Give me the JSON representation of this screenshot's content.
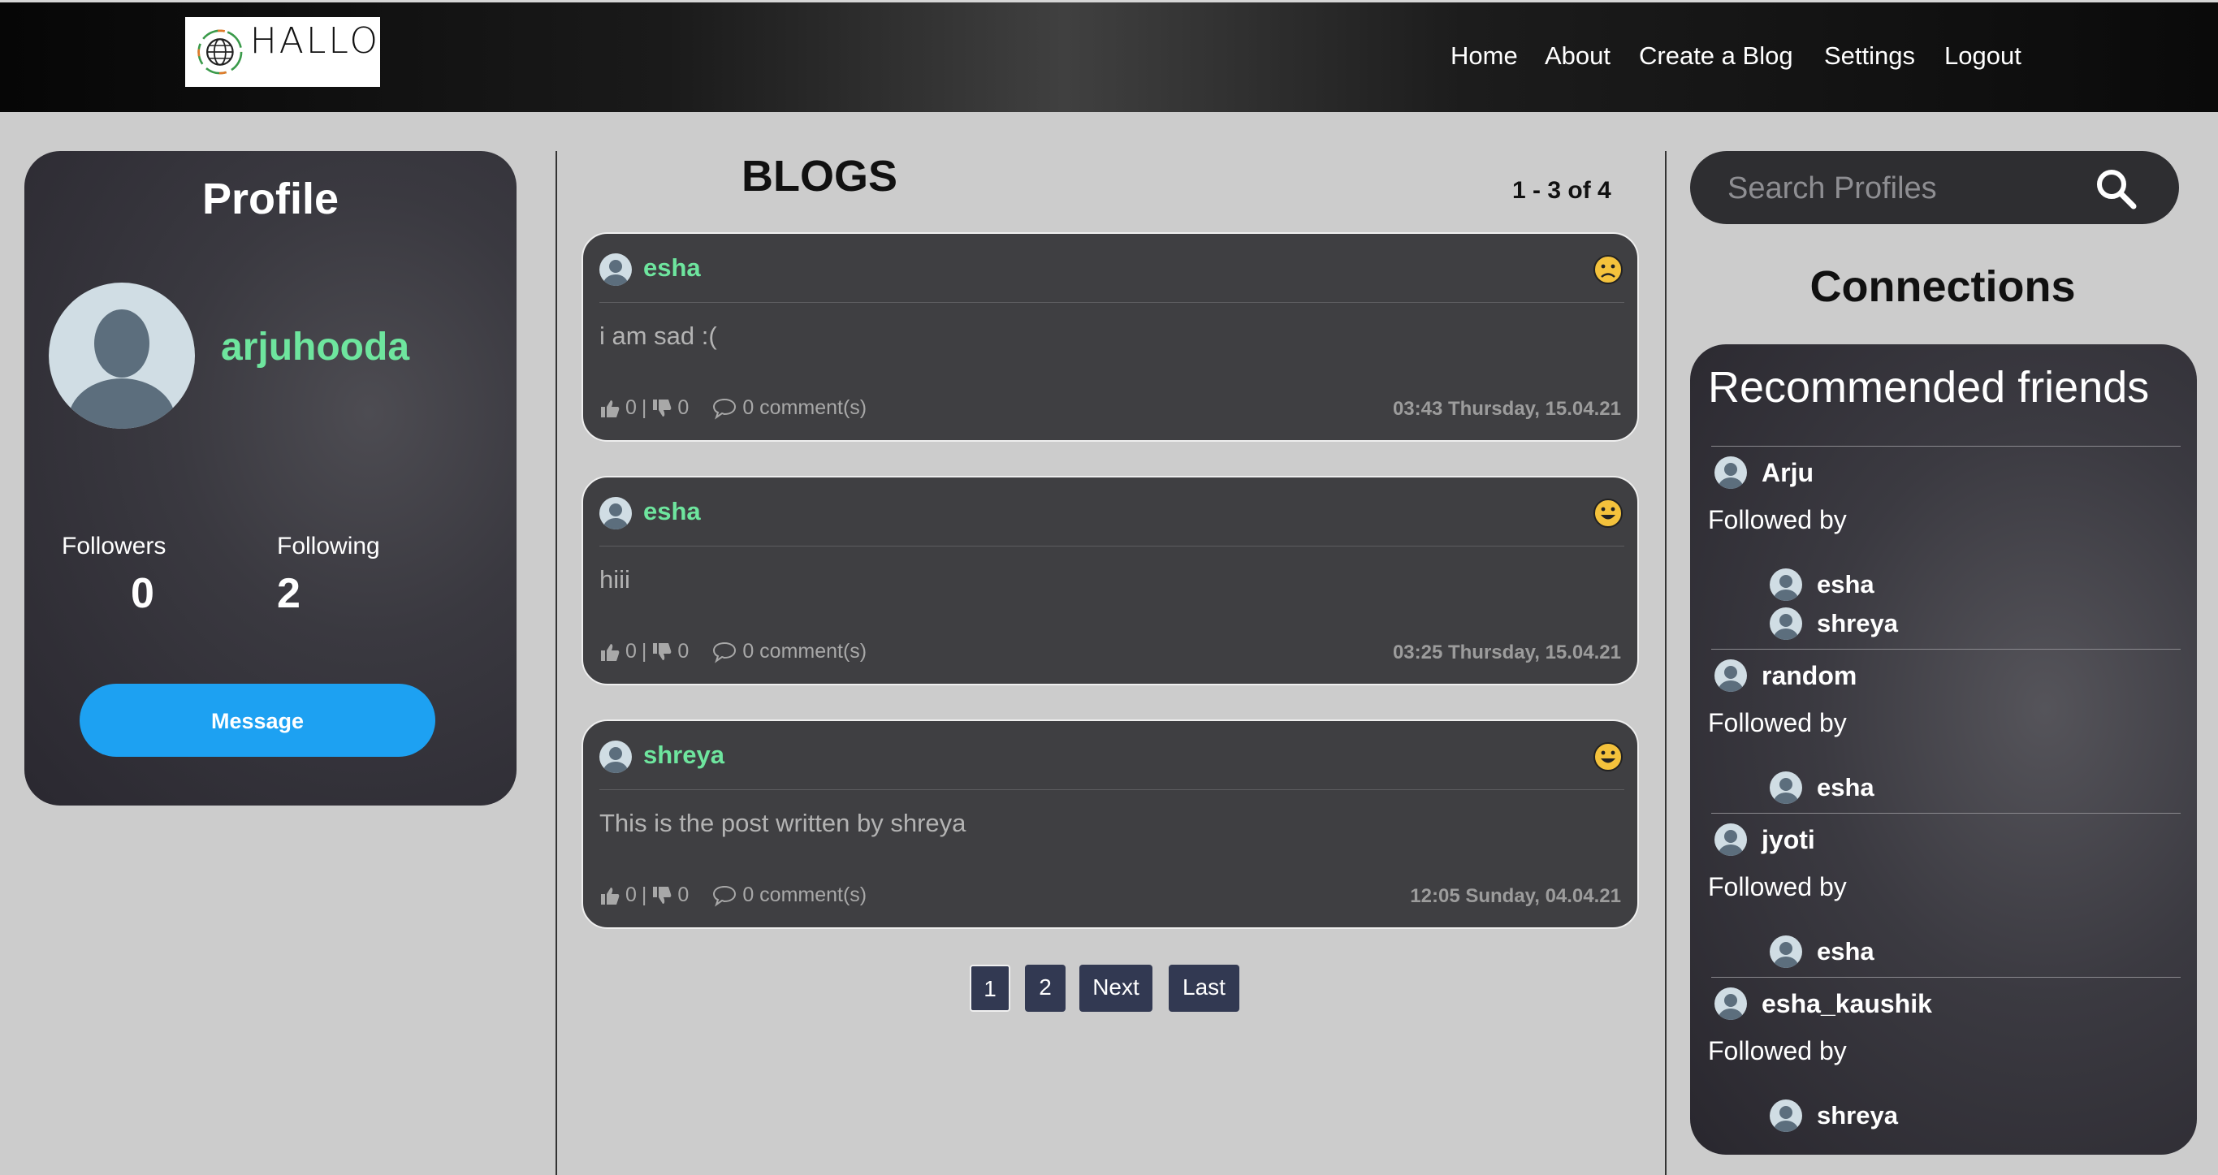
{
  "brand": {
    "logo_text": "HALLO"
  },
  "nav": [
    {
      "label": "Home"
    },
    {
      "label": "About"
    },
    {
      "label": "Create a Blog"
    },
    {
      "label": "Settings"
    },
    {
      "label": "Logout"
    }
  ],
  "profile": {
    "title": "Profile",
    "username": "arjuhooda",
    "followers_label": "Followers",
    "followers": "0",
    "following_label": "Following",
    "following": "2",
    "message_button": "Message"
  },
  "blogs": {
    "title": "BLOGS",
    "count": "1 - 3 of 4",
    "posts": [
      {
        "author": "esha",
        "mood": "sad",
        "body": "i am sad :(",
        "likes": "0",
        "dislikes": "0",
        "comments": "0 comment(s)",
        "time": "03:43 Thursday, 15.04.21"
      },
      {
        "author": "esha",
        "mood": "happy",
        "body": "hiii",
        "likes": "0",
        "dislikes": "0",
        "comments": "0 comment(s)",
        "time": "03:25 Thursday, 15.04.21"
      },
      {
        "author": "shreya",
        "mood": "happy",
        "body": "This is the post written by shreya",
        "likes": "0",
        "dislikes": "0",
        "comments": "0 comment(s)",
        "time": "12:05 Sunday, 04.04.21"
      }
    ],
    "pagination": [
      {
        "label": "1",
        "active": true
      },
      {
        "label": "2"
      },
      {
        "label": "Next"
      },
      {
        "label": "Last"
      }
    ]
  },
  "search": {
    "placeholder": "Search Profiles"
  },
  "connections": {
    "title": "Connections",
    "recommended_title": "Recommended friends",
    "followed_by_label": "Followed by",
    "friends": [
      {
        "name": "Arju",
        "followed_by": [
          "esha",
          "shreya"
        ]
      },
      {
        "name": "random",
        "followed_by": [
          "esha"
        ]
      },
      {
        "name": "jyoti",
        "followed_by": [
          "esha"
        ]
      },
      {
        "name": "esha_kaushik",
        "followed_by": [
          "shreya"
        ]
      }
    ]
  },
  "colors": {
    "accent_green": "#6ee59e",
    "button_blue": "#1da1f2",
    "pager_navy": "#323952",
    "page_bg": "#cccccc"
  }
}
